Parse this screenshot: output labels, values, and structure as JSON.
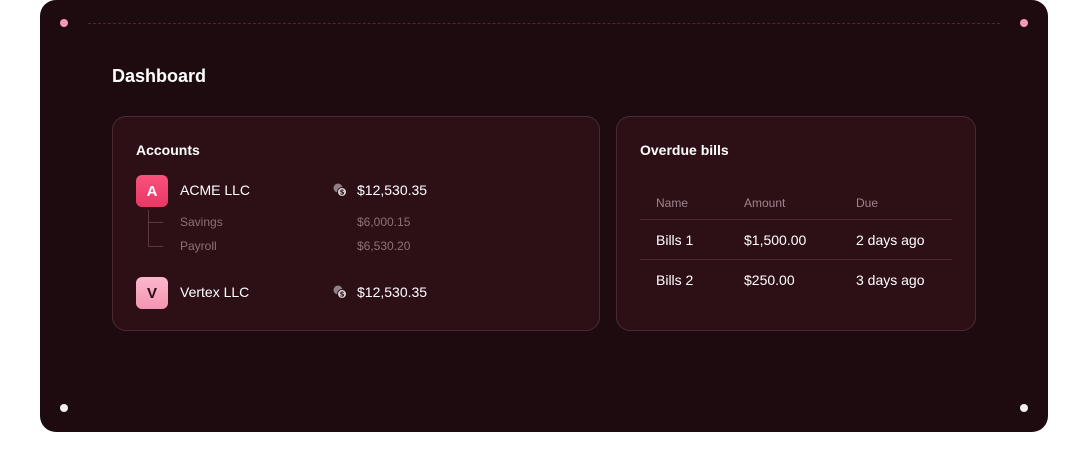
{
  "dashboard": {
    "title": "Dashboard"
  },
  "accounts": {
    "title": "Accounts",
    "items": [
      {
        "initial": "A",
        "name": "ACME LLC",
        "total": "$12,530.35",
        "icon": "coins-icon",
        "avatar_color": "#f24a73",
        "sub_accounts": [
          {
            "label": "Savings",
            "amount": "$6,000.15"
          },
          {
            "label": "Payroll",
            "amount": "$6,530.20"
          }
        ]
      },
      {
        "initial": "V",
        "name": "Vertex LLC",
        "total": "$12,530.35",
        "icon": "coins-icon",
        "avatar_color": "#f7a6be"
      }
    ]
  },
  "overdue_bills": {
    "title": "Overdue bills",
    "columns": [
      "Name",
      "Amount",
      "Due"
    ],
    "rows": [
      [
        "Bills 1",
        "$1,500.00",
        "2 days ago"
      ],
      [
        "Bills 2",
        "$250.00",
        "3 days ago"
      ]
    ]
  },
  "colors": {
    "background": "#1e0b0f",
    "card": "#2d1016",
    "accent_pink": "#f24a73",
    "border": "#4d2a31"
  }
}
